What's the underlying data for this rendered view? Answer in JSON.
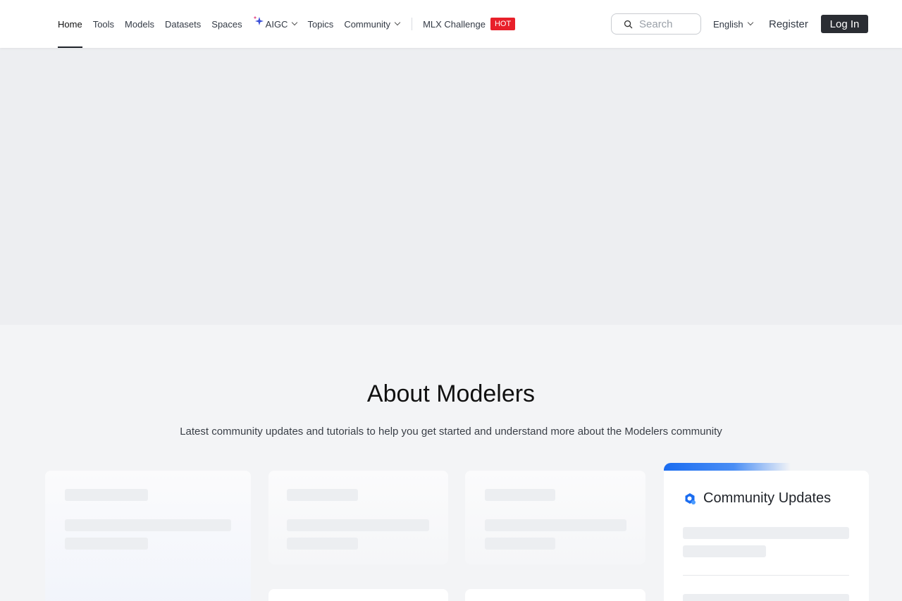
{
  "nav": {
    "items": [
      {
        "label": "Home",
        "active": true
      },
      {
        "label": "Tools"
      },
      {
        "label": "Models"
      },
      {
        "label": "Datasets"
      },
      {
        "label": "Spaces"
      }
    ],
    "aigc": "AIGC",
    "topics": "Topics",
    "community": "Community",
    "mlx": "MLX Challenge",
    "hot_badge": "HOT"
  },
  "search": {
    "placeholder": "Search"
  },
  "language": "English",
  "register": "Register",
  "login": "Log In",
  "about": {
    "title": "About Modelers",
    "subtitle": "Latest community updates and tutorials to help you get started and understand more about the Modelers community"
  },
  "updates": {
    "title": "Community Updates"
  },
  "colors": {
    "accent": "#1a6cf0",
    "hot": "#e8202a",
    "login_bg": "#2a2d33"
  }
}
